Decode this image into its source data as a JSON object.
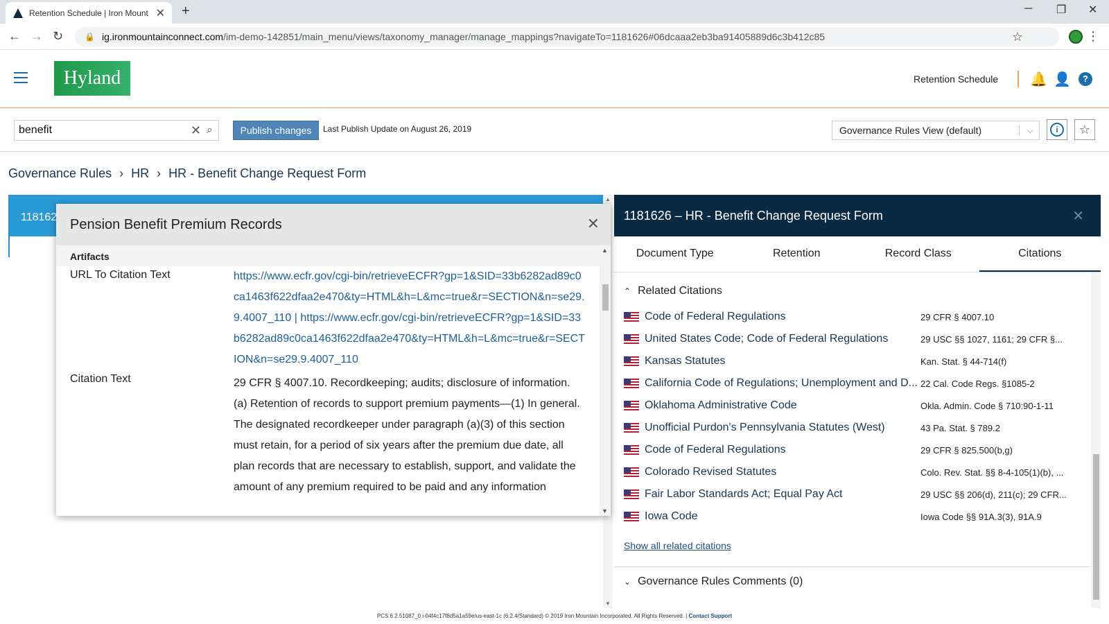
{
  "browser": {
    "tab_title": "Retention Schedule | Iron Mount",
    "url_host": "ig.ironmountainconnect.com",
    "url_path": "/im-demo-142851/main_menu/views/taxonomy_manager/manage_mappings?navigateTo=1181626#06dcaaa2eb3ba91405889d6c3b412c85"
  },
  "header": {
    "logo_text": "Hyland",
    "section": "Retention Schedule"
  },
  "toolbar": {
    "search_value": "benefit",
    "publish_label": "Publish changes",
    "last_publish": "Last Publish Update on August 26, 2019",
    "view_selected": "Governance Rules View (default)"
  },
  "breadcrumb": [
    "Governance Rules",
    "HR",
    "HR - Benefit Change Request Form"
  ],
  "left_card_id": "118162",
  "modal": {
    "title": "Pension Benefit Premium Records",
    "section": "Artifacts",
    "url_label": "URL To Citation Text",
    "url_value": "https://www.ecfr.gov/cgi-bin/retrieveECFR?gp=1&SID=33b6282ad89c0ca1463f622dfaa2e470&ty=HTML&h=L&mc=true&r=SECTION&n=se29.9.4007_110 | https://www.ecfr.gov/cgi-bin/retrieveECFR?gp=1&SID=33b6282ad89c0ca1463f622dfaa2e470&ty=HTML&h=L&mc=true&r=SECTION&n=se29.9.4007_110",
    "citation_label": "Citation Text",
    "citation_text": "29 CFR § 4007.10.   Recordkeeping; audits; disclosure of information. (a) Retention of records to support premium payments—(1) In general. The designated recordkeeper under paragraph (a)(3) of this section must retain, for a period of six years after the premium due date, all plan records that are necessary to establish, support, and validate the amount of any premium required to be paid and any information"
  },
  "panel": {
    "title": "1181626 – HR - Benefit Change Request Form",
    "tabs": [
      "Document Type",
      "Retention",
      "Record Class",
      "Citations"
    ],
    "related_heading": "Related Citations",
    "citations": [
      {
        "name": "Code of Federal Regulations",
        "ref": "29 CFR § 4007.10"
      },
      {
        "name": "United States Code; Code of Federal Regulations",
        "ref": "29 USC §§ 1027, 1161; 29 CFR §..."
      },
      {
        "name": "Kansas Statutes",
        "ref": "Kan. Stat. § 44-714(f)"
      },
      {
        "name": "California Code of Regulations; Unemployment and D...",
        "ref": "22 Cal. Code Regs. §1085-2"
      },
      {
        "name": "Oklahoma Administrative Code",
        "ref": "Okla. Admin. Code § 710:90-1-11"
      },
      {
        "name": "Unofficial Purdon's Pennsylvania Statutes (West)",
        "ref": "43 Pa. Stat. § 789.2"
      },
      {
        "name": "Code of Federal Regulations",
        "ref": "29 CFR § 825.500(b,g)"
      },
      {
        "name": "Colorado Revised Statutes",
        "ref": "Colo. Rev. Stat. §§ 8-4-105(1)(b), ..."
      },
      {
        "name": "Fair Labor Standards Act; Equal Pay Act",
        "ref": "29 USC §§ 206(d), 211(c); 29 CFR..."
      },
      {
        "name": "Iowa Code",
        "ref": "Iowa Code §§ 91A.3(3), 91A.9"
      }
    ],
    "show_all": "Show all related citations",
    "comments": "Governance Rules Comments (0)"
  },
  "footer": {
    "text": "PCS 6.2.51087_0 i-04f4c17f8d5a1a59e/us-east-1c (6.2.4/Standard) © 2019 Iron Mountain Incorporated. All Rights Reserved. |",
    "link": "Contact Support"
  }
}
